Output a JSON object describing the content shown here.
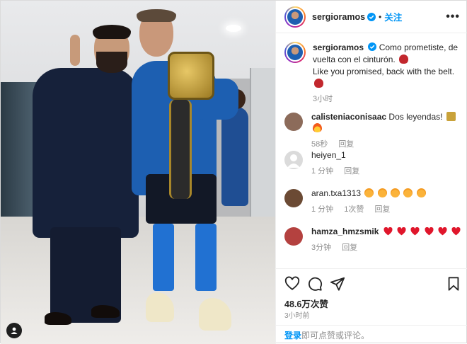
{
  "header": {
    "username": "sergioramos",
    "follow_label": "关注",
    "separator": "•",
    "more_label": "•••"
  },
  "caption": {
    "username": "sergioramos",
    "text_es": "Como prometiste, de vuelta con el cinturón.",
    "text_en": "Like you promised, back with the belt.",
    "time": "3小时"
  },
  "comments": [
    {
      "username": "calisteniaconisaac",
      "text": "Dos leyendas!",
      "time": "58秒",
      "reply": "回复",
      "likes": "",
      "avatar_color": "#8c6b5a"
    },
    {
      "username": "heiyen_1",
      "text": "",
      "time": "1 分钟",
      "reply": "回复",
      "likes": "",
      "avatar_color": "#dbdbdb"
    },
    {
      "username": "aran.txa1313",
      "text": "",
      "time": "1 分钟",
      "reply": "回复",
      "likes": "1次赞",
      "avatar_color": "#6b4a34"
    },
    {
      "username": "hamza_hmzsmik",
      "text": "",
      "time": "3分钟",
      "reply": "回复",
      "likes": "",
      "avatar_color": "#b4413f"
    }
  ],
  "actions": {
    "likes_count": "48.6万次赞",
    "posted_ago": "3小时前"
  },
  "login": {
    "link_label": "登录",
    "suffix": "即可点赞或评论。"
  },
  "colors": {
    "accent_blue": "#0095f6",
    "heart_red": "#ed4956",
    "muted_text": "#8e8e8e",
    "border": "#efefef"
  },
  "icons": [
    "verified-badge-icon",
    "heart-icon",
    "comment-icon",
    "share-icon",
    "bookmark-icon",
    "more-options-icon",
    "user-tag-icon"
  ]
}
